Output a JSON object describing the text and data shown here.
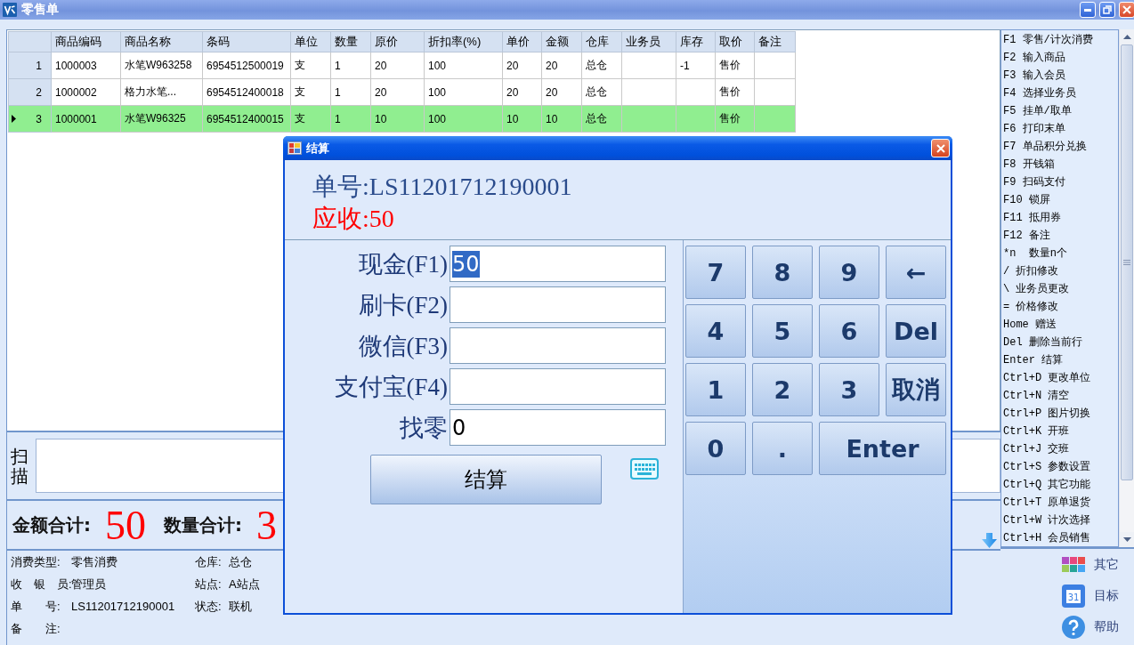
{
  "window": {
    "title": "零售单"
  },
  "table": {
    "columns": [
      "商品编码",
      "商品名称",
      "条码",
      "单位",
      "数量",
      "原价",
      "折扣率(%)",
      "单价",
      "金额",
      "仓库",
      "业务员",
      "库存",
      "取价",
      "备注"
    ],
    "rows": [
      {
        "number": "1",
        "selected": false,
        "cells": [
          "1000003",
          "水笔W963258",
          "6954512500019",
          "支",
          "1",
          "20",
          "100",
          "20",
          "20",
          "总仓",
          null,
          "-1",
          "售价",
          null
        ]
      },
      {
        "number": "2",
        "selected": false,
        "cells": [
          "1000002",
          "格力水笔...",
          "6954512400018",
          "支",
          "1",
          "20",
          "100",
          "20",
          "20",
          "总仓",
          null,
          null,
          "售价",
          null
        ]
      },
      {
        "number": "3",
        "selected": true,
        "cells": [
          "1000001",
          "水笔W96325",
          "6954512400015",
          "支",
          "1",
          "10",
          "100",
          "10",
          "10",
          "总仓",
          null,
          null,
          "售价",
          null
        ]
      }
    ]
  },
  "scan": {
    "label": "扫描"
  },
  "totals": [
    {
      "label": "金额合计:",
      "value": "50"
    },
    {
      "label": "数量合计:",
      "value": "3"
    }
  ],
  "info": {
    "left": [
      {
        "label": "消费类型:",
        "value": "零售消费"
      },
      {
        "label": "收　银　员:",
        "value": "管理员"
      },
      {
        "label": "单　　号:",
        "value": "LS11201712190001"
      },
      {
        "label": "备　　注:"
      }
    ],
    "right": [
      {
        "label": "仓库:",
        "value": "总仓"
      },
      {
        "label": "站点:",
        "value": "A站点"
      },
      {
        "label": "状态:",
        "value": "联机"
      }
    ]
  },
  "shortcuts": [
    "F1 零售/计次消费",
    "F2 输入商品",
    "F3 输入会员",
    "F4 选择业务员",
    "F5 挂单/取单",
    "F6 打印末单",
    "F7 单品积分兑换",
    "F8 开钱箱",
    "F9 扫码支付",
    "F10 锁屏",
    "F11 抵用券",
    "F12 备注",
    "*n  数量n个",
    "/ 折扣修改",
    "\\ 业务员更改",
    "= 价格修改",
    "Home 赠送",
    "Del 删除当前行",
    "Enter 结算",
    "Ctrl+D 更改单位",
    "Ctrl+N 清空",
    "Ctrl+P 图片切换",
    "Ctrl+K 开班",
    "Ctrl+J 交班",
    "Ctrl+S 参数设置",
    "Ctrl+Q 其它功能",
    "Ctrl+T 原单退货",
    "Ctrl+W 计次选择",
    "Ctrl+H 会员销售"
  ],
  "tools": [
    {
      "kind": "apps",
      "label": "其它"
    },
    {
      "kind": "calendar",
      "label": "目标",
      "icon_text": "31"
    },
    {
      "kind": "help",
      "label": "帮助"
    }
  ],
  "dialog": {
    "title": "结算",
    "order": "单号:LS11201712190001",
    "receivable": "应收:50",
    "payments": [
      {
        "label": "现金(F1)",
        "value": "50",
        "highlighted": true
      },
      {
        "label": "刷卡(F2)",
        "highlighted": false
      },
      {
        "label": "微信(F3)",
        "highlighted": false
      },
      {
        "label": "支付宝(F4)",
        "highlighted": false
      },
      {
        "label": "找零",
        "value": "0",
        "highlighted": false
      }
    ],
    "submit": "结算",
    "keys": [
      {
        "label": "7",
        "wide": false
      },
      {
        "label": "8",
        "wide": false
      },
      {
        "label": "9",
        "wide": false
      },
      {
        "label": "←",
        "wide": false
      },
      {
        "label": "4",
        "wide": false
      },
      {
        "label": "5",
        "wide": false
      },
      {
        "label": "6",
        "wide": false
      },
      {
        "label": "Del",
        "wide": false
      },
      {
        "label": "1",
        "wide": false
      },
      {
        "label": "2",
        "wide": false
      },
      {
        "label": "3",
        "wide": false
      },
      {
        "label": "取消",
        "wide": false
      },
      {
        "label": "0",
        "wide": false
      },
      {
        "label": ".",
        "wide": false
      },
      {
        "label": "Enter",
        "wide": true
      }
    ]
  }
}
